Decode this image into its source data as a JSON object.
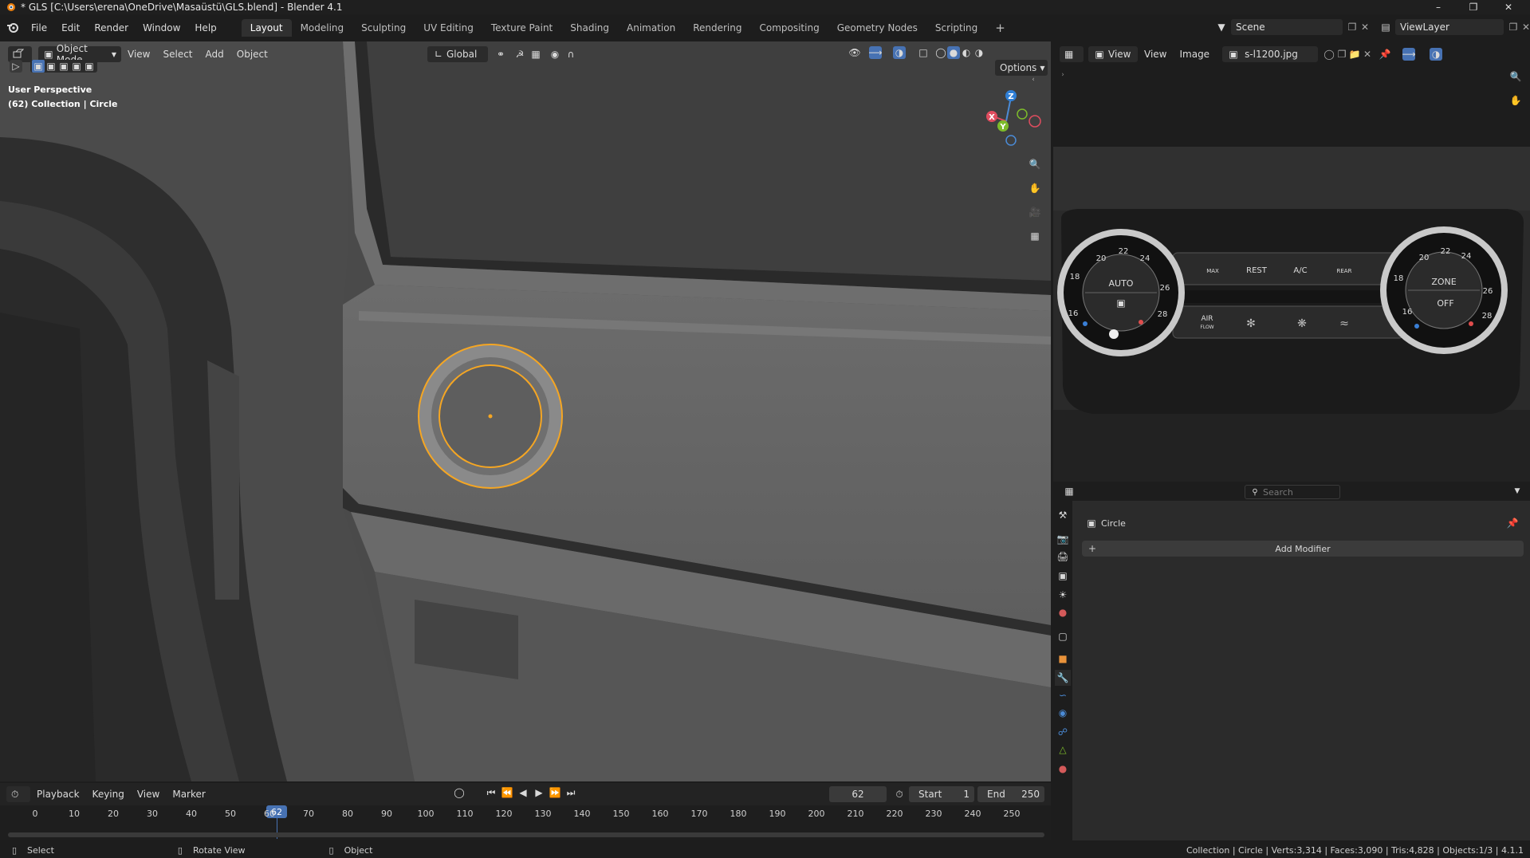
{
  "window": {
    "title": "* GLS [C:\\Users\\erena\\OneDrive\\Masaüstü\\GLS.blend] - Blender 4.1"
  },
  "menu": {
    "items": [
      "File",
      "Edit",
      "Render",
      "Window",
      "Help"
    ]
  },
  "workspaces": [
    "Layout",
    "Modeling",
    "Sculpting",
    "UV Editing",
    "Texture Paint",
    "Shading",
    "Animation",
    "Rendering",
    "Compositing",
    "Geometry Nodes",
    "Scripting"
  ],
  "active_workspace": "Layout",
  "scene": {
    "name": "Scene",
    "view_layer": "ViewLayer"
  },
  "viewport_header": {
    "mode": "Object Mode",
    "menus": [
      "View",
      "Select",
      "Add",
      "Object"
    ],
    "transform_orientation": "Global",
    "options": "Options"
  },
  "viewport": {
    "perspective": "User Perspective",
    "collection_info": "(62) Collection | Circle",
    "gizmo": {
      "z": "Z",
      "y": "Y",
      "x": "X"
    }
  },
  "image_editor": {
    "view_menu": "View",
    "menus": [
      "View",
      "Image"
    ],
    "image_name": "s-l1200.jpg",
    "panel_labels": {
      "auto": "AUTO",
      "zone": "ZONE",
      "off": "OFF",
      "rest": "REST",
      "ac": "A/C",
      "max": "MAX",
      "rear": "REAR",
      "air": "AIR",
      "flow": "FLOW",
      "left_temps": [
        "20",
        "22",
        "24",
        "18",
        "26",
        "16",
        "28"
      ],
      "right_temps": [
        "20",
        "22",
        "24",
        "18",
        "26",
        "16",
        "28"
      ]
    }
  },
  "properties": {
    "search_placeholder": "Search",
    "object_name": "Circle",
    "add_modifier": "Add Modifier"
  },
  "timeline": {
    "menus": [
      "Playback",
      "Keying",
      "View",
      "Marker"
    ],
    "current_frame": "62",
    "start_label": "Start",
    "start": "1",
    "end_label": "End",
    "end": "250",
    "ticks": [
      "0",
      "10",
      "20",
      "30",
      "40",
      "50",
      "60",
      "70",
      "80",
      "90",
      "100",
      "110",
      "120",
      "130",
      "140",
      "150",
      "160",
      "170",
      "180",
      "190",
      "200",
      "210",
      "220",
      "230",
      "240",
      "250"
    ],
    "playhead_label": "62"
  },
  "statusbar": {
    "select": "Select",
    "rotate": "Rotate View",
    "object": "Object",
    "stats": "Collection | Circle | Verts:3,314 | Faces:3,090 | Tris:4,828 | Objects:1/3 | 4.1.1"
  },
  "colors": {
    "accent": "#4772b3",
    "selection": "#f5a623",
    "bg": "#1d1d1d"
  }
}
